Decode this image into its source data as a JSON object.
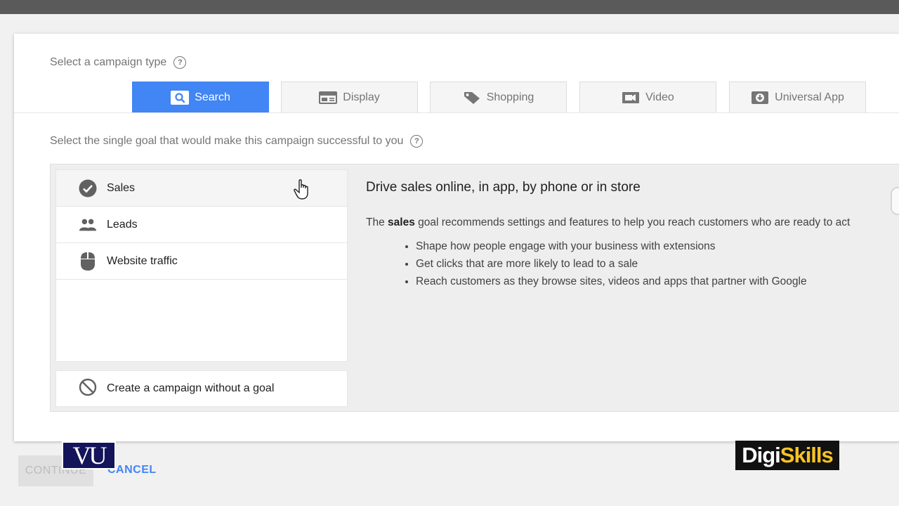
{
  "campaign_type": {
    "label": "Select a campaign type",
    "tabs": [
      {
        "label": "Search",
        "icon": "search-icon",
        "active": true
      },
      {
        "label": "Display",
        "icon": "display-icon",
        "active": false
      },
      {
        "label": "Shopping",
        "icon": "tag-icon",
        "active": false
      },
      {
        "label": "Video",
        "icon": "video-camera-icon",
        "active": false
      },
      {
        "label": "Universal App",
        "icon": "download-icon",
        "active": false
      }
    ]
  },
  "goal": {
    "label": "Select the single goal that would make this campaign successful to you",
    "items": [
      {
        "label": "Sales",
        "icon": "check-circle-icon",
        "selected": true
      },
      {
        "label": "Leads",
        "icon": "people-icon",
        "selected": false
      },
      {
        "label": "Website traffic",
        "icon": "mouse-icon",
        "selected": false
      }
    ],
    "no_goal_label": "Create a campaign without a goal"
  },
  "detail": {
    "title": "Drive sales online, in app, by phone or in store",
    "desc_prefix": "The",
    "desc_bold": "sales",
    "desc_suffix": "goal recommends settings and features to help you reach customers who are ready to act",
    "bullets": [
      "Shape how people engage with your business with extensions",
      "Get clicks that are more likely to lead to a sale",
      "Reach customers as they browse sites, videos and apps that partner with Google"
    ]
  },
  "actions": {
    "continue_label": "CONTINUE",
    "cancel_label": "CANCEL"
  },
  "watermarks": {
    "vu": "VU",
    "digi_prefix": "Digi",
    "digi_suffix": "Skills"
  },
  "colors": {
    "accent": "#4285f4",
    "panel": "#eeeeee"
  }
}
